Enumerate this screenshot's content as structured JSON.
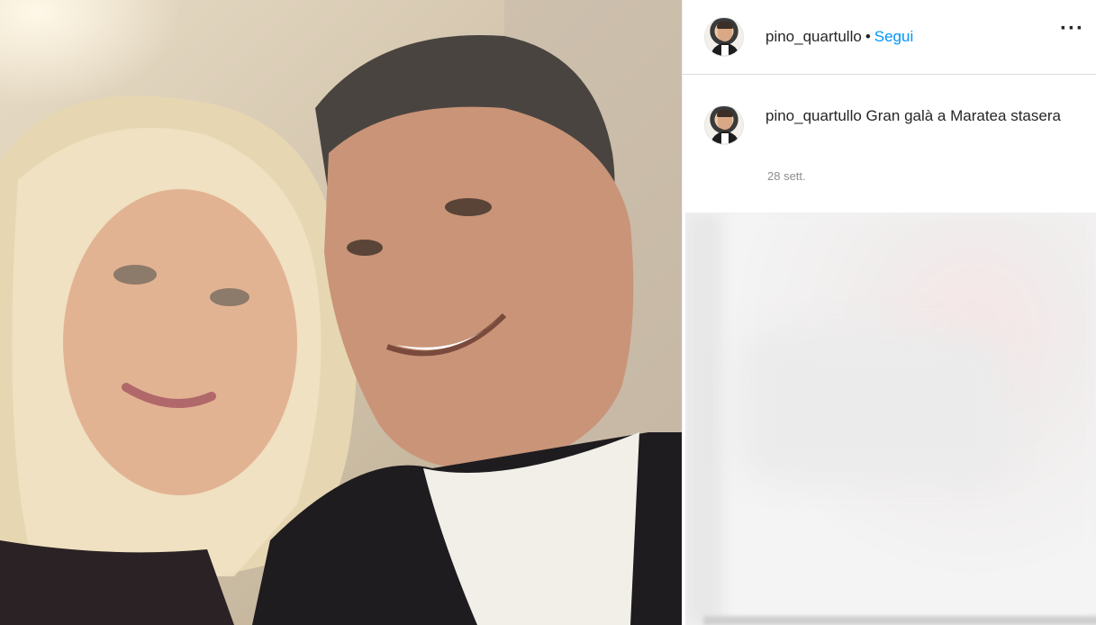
{
  "post": {
    "username": "pino_quartullo",
    "separator": "•",
    "follow_label": "Segui",
    "more_label": "···",
    "caption_user": "pino_quartullo",
    "caption_text": "Gran galà a Maratea stasera",
    "time_ago": "28 sett."
  },
  "icons": {
    "profile": "avatar",
    "more": "more-options-icon"
  },
  "colors": {
    "link": "#0095f6",
    "text": "#262626",
    "meta": "#8e8e8e",
    "divider": "#dbdbdb"
  }
}
